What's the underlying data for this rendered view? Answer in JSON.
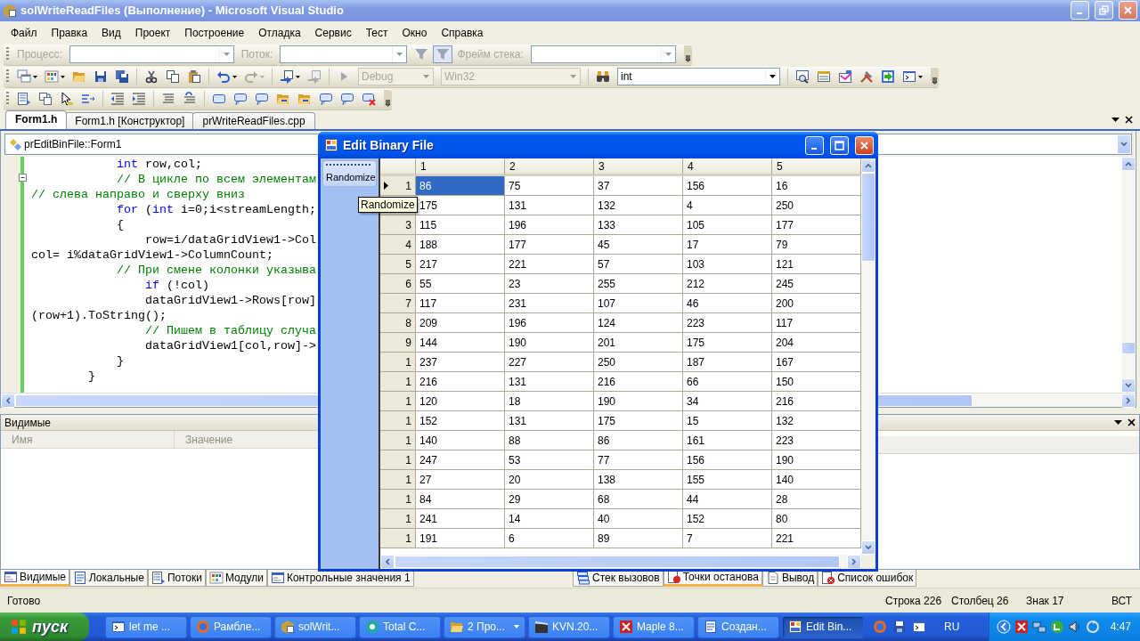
{
  "window": {
    "title": "solWriteReadFiles (Выполнение) - Microsoft Visual Studio"
  },
  "menu": [
    "Файл",
    "Правка",
    "Вид",
    "Проект",
    "Построение",
    "Отладка",
    "Сервис",
    "Тест",
    "Окно",
    "Справка"
  ],
  "debug_toolbar": {
    "disabled": true,
    "process_label": "Процесс:",
    "thread_label": "Поток:",
    "stack_frame_label": "Фрейм стека:"
  },
  "standard_toolbar": {
    "configuration": {
      "value": "Debug",
      "disabled": true
    },
    "platform": {
      "value": "Win32",
      "disabled": true
    },
    "find": {
      "value": "int",
      "disabled": false
    }
  },
  "document_tabs": [
    {
      "label": "Form1.h",
      "selected": true
    },
    {
      "label": "Form1.h [Конструктор]",
      "selected": false
    },
    {
      "label": "prWriteReadFiles.cpp",
      "selected": false
    }
  ],
  "editor": {
    "navigation": "prEditBinFile::Form1",
    "lines": [
      [
        {
          "kind": "keyword",
          "text": "            int"
        },
        {
          "kind": "plain",
          "text": " row,col;"
        }
      ],
      [
        {
          "kind": "comment",
          "text": "            // В цикле по всем элементам"
        }
      ],
      [
        {
          "kind": "comment",
          "text": "// слева направо и сверху вниз"
        }
      ],
      [
        {
          "kind": "keyword",
          "text": "            for"
        },
        {
          "kind": "plain",
          "text": " ("
        },
        {
          "kind": "keyword",
          "text": "int"
        },
        {
          "kind": "plain",
          "text": " i=0;i<streamLength;"
        }
      ],
      [
        {
          "kind": "plain",
          "text": "            {"
        }
      ],
      [
        {
          "kind": "plain",
          "text": "                row=i/dataGridView1->Col"
        }
      ],
      [
        {
          "kind": "plain",
          "text": "col= i%dataGridView1->ColumnCount;"
        }
      ],
      [
        {
          "kind": "comment",
          "text": "            // При смене колонки указыва"
        }
      ],
      [
        {
          "kind": "keyword",
          "text": "                if"
        },
        {
          "kind": "plain",
          "text": " (!col)"
        }
      ],
      [
        {
          "kind": "plain",
          "text": "                dataGridView1->Rows[row]"
        }
      ],
      [
        {
          "kind": "plain",
          "text": "(row+1).ToString();"
        }
      ],
      [
        {
          "kind": "comment",
          "text": "                // Пишем в таблицу случа"
        }
      ],
      [
        {
          "kind": "plain",
          "text": "                dataGridView1[col,row]->"
        }
      ],
      [
        {
          "kind": "plain",
          "text": "            }"
        }
      ],
      [
        {
          "kind": "plain",
          "text": "        }"
        }
      ]
    ]
  },
  "watch_panel": {
    "title": "Видимые",
    "columns": [
      "Имя",
      "Значение"
    ]
  },
  "left_tool_tabs": [
    {
      "label": "Видимые",
      "selected": true
    },
    {
      "label": "Локальные",
      "selected": false
    },
    {
      "label": "Потоки",
      "selected": false
    },
    {
      "label": "Модули",
      "selected": false
    },
    {
      "label": "Контрольные значения 1",
      "selected": false
    }
  ],
  "right_tool_tabs": [
    {
      "label": "Стек вызовов",
      "selected": false
    },
    {
      "label": "Точки останова",
      "selected": true
    },
    {
      "label": "Вывод",
      "selected": false
    },
    {
      "label": "Список ошибок",
      "selected": false
    }
  ],
  "status_bar": {
    "message": "Готово",
    "line": "Строка 226",
    "column": "Столбец 26",
    "char": "Знак 17",
    "mode": "ВСТ"
  },
  "taskbar": {
    "start": "пуск",
    "tasks": [
      {
        "label": "let me ...",
        "kind": "window",
        "selected": false
      },
      {
        "label": "Рамбле...",
        "kind": "window",
        "selected": false
      },
      {
        "label": "solWrit...",
        "kind": "window",
        "selected": false
      },
      {
        "label": "Total C...",
        "kind": "window",
        "selected": false
      },
      {
        "label": "2 Про...",
        "kind": "group",
        "selected": false
      },
      {
        "label": "KVN.20...",
        "kind": "window",
        "selected": false
      },
      {
        "label": "Maple 8...",
        "kind": "window",
        "selected": false
      },
      {
        "label": "Создан...",
        "kind": "window",
        "selected": false
      },
      {
        "label": "Edit Bin...",
        "kind": "window",
        "selected": true
      }
    ],
    "language": "RU",
    "clock": "4:47"
  },
  "dialog": {
    "title": "Edit Binary File",
    "toolstrip_button": "Randomize",
    "tooltip": "Randomize",
    "grid": {
      "columns": [
        "1",
        "2",
        "3",
        "4",
        "5"
      ],
      "rows": [
        {
          "header": "1",
          "current": true,
          "cells": [
            {
              "text": "86",
              "selected": true
            },
            {
              "text": "75",
              "selected": false
            },
            {
              "text": "37",
              "selected": false
            },
            {
              "text": "156",
              "selected": false
            },
            {
              "text": "16",
              "selected": false
            }
          ]
        },
        {
          "cells": [
            {
              "text": "175",
              "selected": false
            },
            {
              "text": "131",
              "selected": false
            },
            {
              "text": "132",
              "selected": false
            },
            {
              "text": "4",
              "selected": false
            },
            {
              "text": "250",
              "selected": false
            }
          ]
        },
        {
          "header": "3",
          "current": false,
          "cells": [
            {
              "text": "115",
              "selected": false
            },
            {
              "text": "196",
              "selected": false
            },
            {
              "text": "133",
              "selected": false
            },
            {
              "text": "105",
              "selected": false
            },
            {
              "text": "177",
              "selected": false
            }
          ]
        },
        {
          "header": "4",
          "current": false,
          "cells": [
            {
              "text": "188",
              "selected": false
            },
            {
              "text": "177",
              "selected": false
            },
            {
              "text": "45",
              "selected": false
            },
            {
              "text": "17",
              "selected": false
            },
            {
              "text": "79",
              "selected": false
            }
          ]
        },
        {
          "header": "5",
          "current": false,
          "cells": [
            {
              "text": "217",
              "selected": false
            },
            {
              "text": "221",
              "selected": false
            },
            {
              "text": "57",
              "selected": false
            },
            {
              "text": "103",
              "selected": false
            },
            {
              "text": "121",
              "selected": false
            }
          ]
        },
        {
          "header": "6",
          "current": false,
          "cells": [
            {
              "text": "55",
              "selected": false
            },
            {
              "text": "23",
              "selected": false
            },
            {
              "text": "255",
              "selected": false
            },
            {
              "text": "212",
              "selected": false
            },
            {
              "text": "245",
              "selected": false
            }
          ]
        },
        {
          "header": "7",
          "current": false,
          "cells": [
            {
              "text": "117",
              "selected": false
            },
            {
              "text": "231",
              "selected": false
            },
            {
              "text": "107",
              "selected": false
            },
            {
              "text": "46",
              "selected": false
            },
            {
              "text": "200",
              "selected": false
            }
          ]
        },
        {
          "header": "8",
          "current": false,
          "cells": [
            {
              "text": "209",
              "selected": false
            },
            {
              "text": "196",
              "selected": false
            },
            {
              "text": "124",
              "selected": false
            },
            {
              "text": "223",
              "selected": false
            },
            {
              "text": "117",
              "selected": false
            }
          ]
        },
        {
          "header": "9",
          "current": false,
          "cells": [
            {
              "text": "144",
              "selected": false
            },
            {
              "text": "190",
              "selected": false
            },
            {
              "text": "201",
              "selected": false
            },
            {
              "text": "175",
              "selected": false
            },
            {
              "text": "204",
              "selected": false
            }
          ]
        },
        {
          "header": "1",
          "current": false,
          "cells": [
            {
              "text": "237",
              "selected": false
            },
            {
              "text": "227",
              "selected": false
            },
            {
              "text": "250",
              "selected": false
            },
            {
              "text": "187",
              "selected": false
            },
            {
              "text": "167",
              "selected": false
            }
          ]
        },
        {
          "header": "1",
          "current": false,
          "cells": [
            {
              "text": "216",
              "selected": false
            },
            {
              "text": "131",
              "selected": false
            },
            {
              "text": "216",
              "selected": false
            },
            {
              "text": "66",
              "selected": false
            },
            {
              "text": "150",
              "selected": false
            }
          ]
        },
        {
          "header": "1",
          "current": false,
          "cells": [
            {
              "text": "120",
              "selected": false
            },
            {
              "text": "18",
              "selected": false
            },
            {
              "text": "190",
              "selected": false
            },
            {
              "text": "34",
              "selected": false
            },
            {
              "text": "216",
              "selected": false
            }
          ]
        },
        {
          "header": "1",
          "current": false,
          "cells": [
            {
              "text": "152",
              "selected": false
            },
            {
              "text": "131",
              "selected": false
            },
            {
              "text": "175",
              "selected": false
            },
            {
              "text": "15",
              "selected": false
            },
            {
              "text": "132",
              "selected": false
            }
          ]
        },
        {
          "header": "1",
          "current": false,
          "cells": [
            {
              "text": "140",
              "selected": false
            },
            {
              "text": "88",
              "selected": false
            },
            {
              "text": "86",
              "selected": false
            },
            {
              "text": "161",
              "selected": false
            },
            {
              "text": "223",
              "selected": false
            }
          ]
        },
        {
          "header": "1",
          "current": false,
          "cells": [
            {
              "text": "247",
              "selected": false
            },
            {
              "text": "53",
              "selected": false
            },
            {
              "text": "77",
              "selected": false
            },
            {
              "text": "156",
              "selected": false
            },
            {
              "text": "190",
              "selected": false
            }
          ]
        },
        {
          "header": "1",
          "current": false,
          "cells": [
            {
              "text": "27",
              "selected": false
            },
            {
              "text": "20",
              "selected": false
            },
            {
              "text": "138",
              "selected": false
            },
            {
              "text": "155",
              "selected": false
            },
            {
              "text": "140",
              "selected": false
            }
          ]
        },
        {
          "header": "1",
          "current": false,
          "cells": [
            {
              "text": "84",
              "selected": false
            },
            {
              "text": "29",
              "selected": false
            },
            {
              "text": "68",
              "selected": false
            },
            {
              "text": "44",
              "selected": false
            },
            {
              "text": "28",
              "selected": false
            }
          ]
        },
        {
          "header": "1",
          "current": false,
          "cells": [
            {
              "text": "241",
              "selected": false
            },
            {
              "text": "14",
              "selected": false
            },
            {
              "text": "40",
              "selected": false
            },
            {
              "text": "152",
              "selected": false
            },
            {
              "text": "80",
              "selected": false
            }
          ]
        },
        {
          "header": "1",
          "current": false,
          "cells": [
            {
              "text": "191",
              "selected": false
            },
            {
              "text": "6",
              "selected": false
            },
            {
              "text": "89",
              "selected": false
            },
            {
              "text": "7",
              "selected": false
            },
            {
              "text": "221",
              "selected": false
            }
          ]
        }
      ]
    }
  }
}
